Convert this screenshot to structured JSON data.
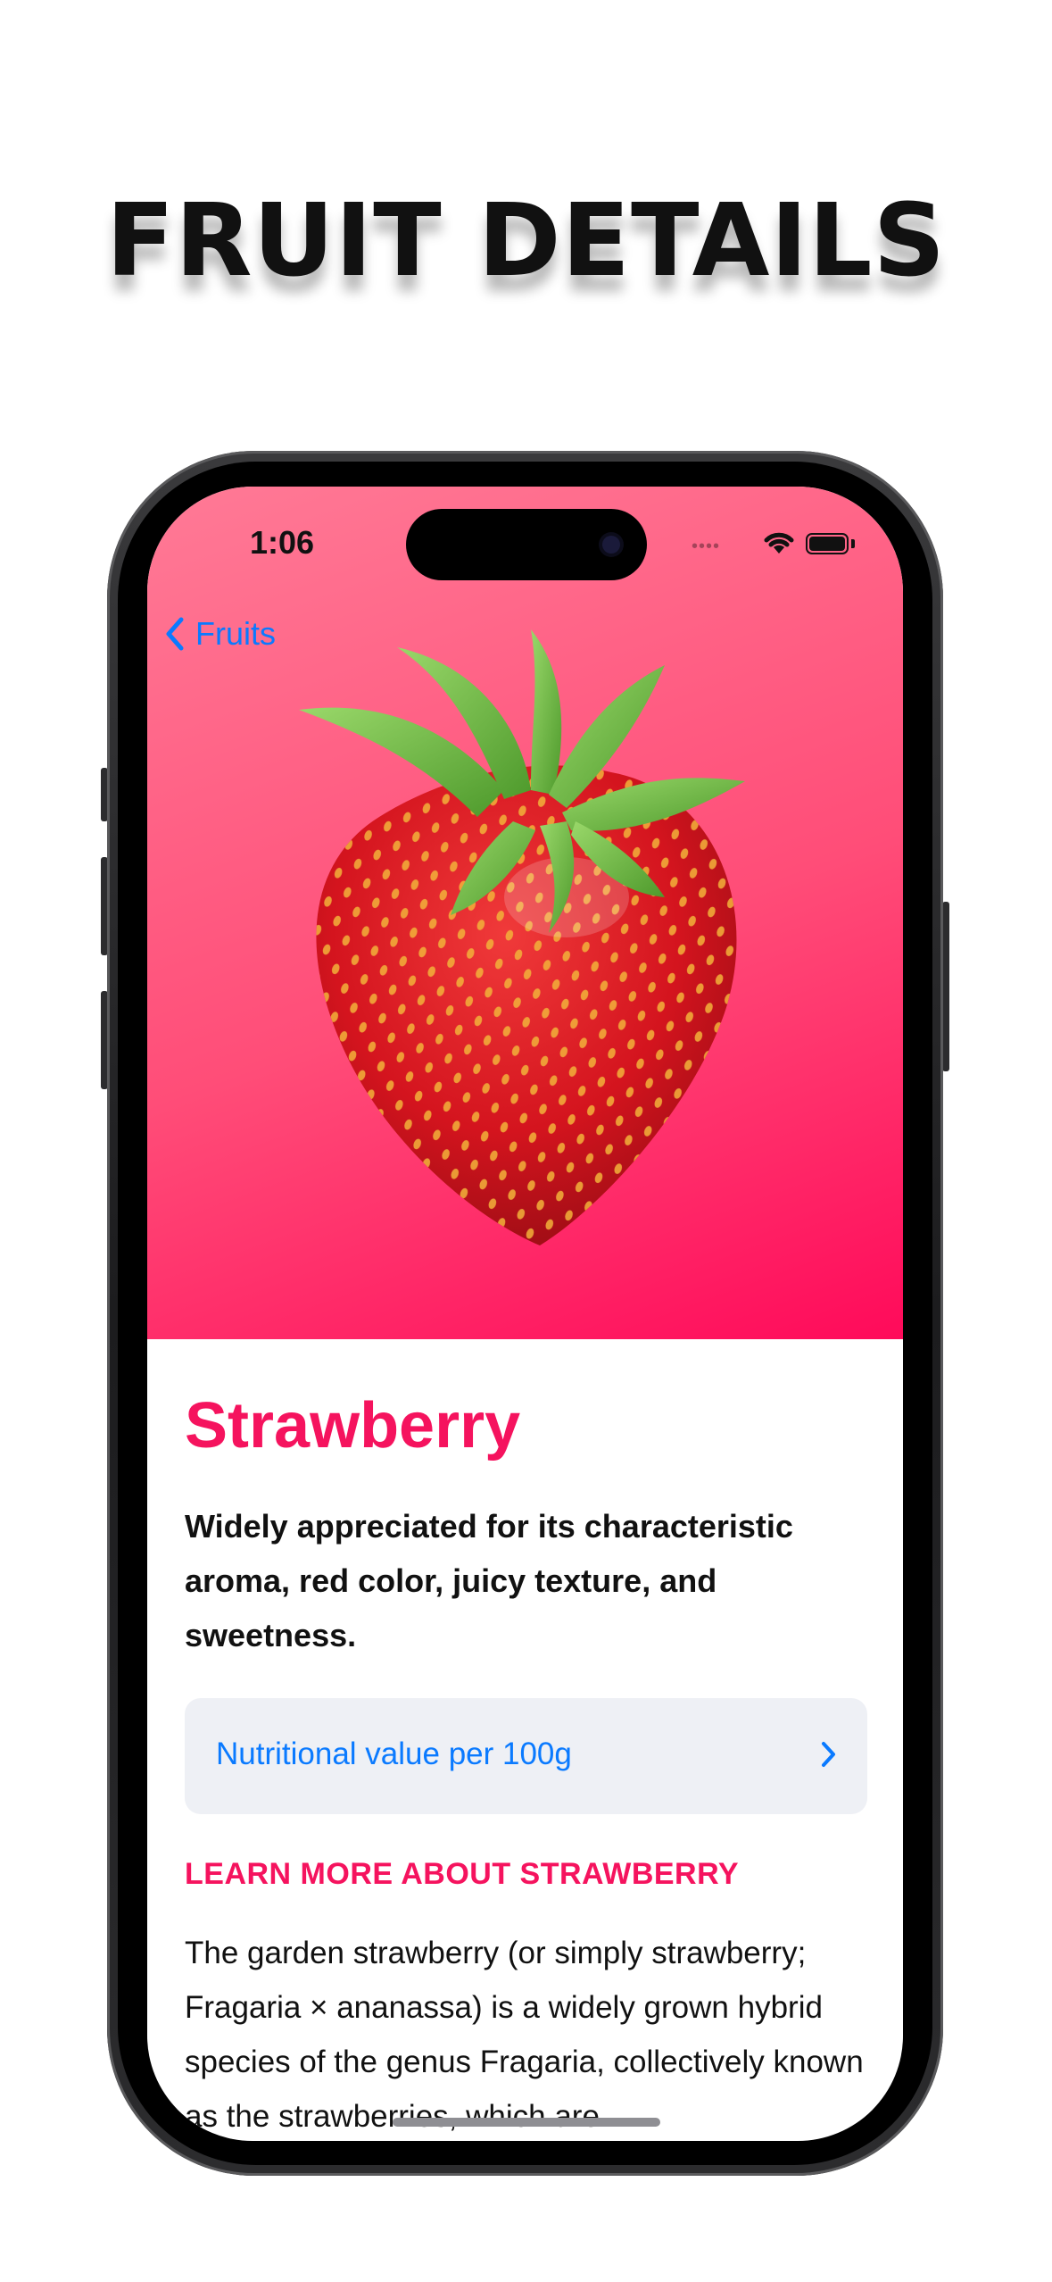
{
  "promo": {
    "title": "FRUIT DETAILS"
  },
  "status_bar": {
    "time": "1:06"
  },
  "nav": {
    "back_label": "Fruits"
  },
  "fruit": {
    "name": "Strawberry",
    "headline": "Widely appreciated for its characteristic aroma,  red color, juicy texture, and sweetness.",
    "nutrition_button_label": "Nutritional value per 100g",
    "learn_more_heading": "LEARN MORE ABOUT STRAWBERRY",
    "description": "The garden strawberry (or simply strawberry; Fragaria × ananassa) is a widely grown hybrid species of the genus Fragaria, collectively known as the strawberries, which are"
  },
  "colors": {
    "accent": "#f5135e",
    "link": "#0a7aff",
    "hero_gradient_start": "#ff7a96",
    "hero_gradient_end": "#ff0a5a",
    "button_bg": "#eef0f5"
  },
  "icons": {
    "back": "chevron-left-icon",
    "nutrition": "chevron-right-icon",
    "wifi": "wifi-icon",
    "battery": "battery-icon"
  }
}
